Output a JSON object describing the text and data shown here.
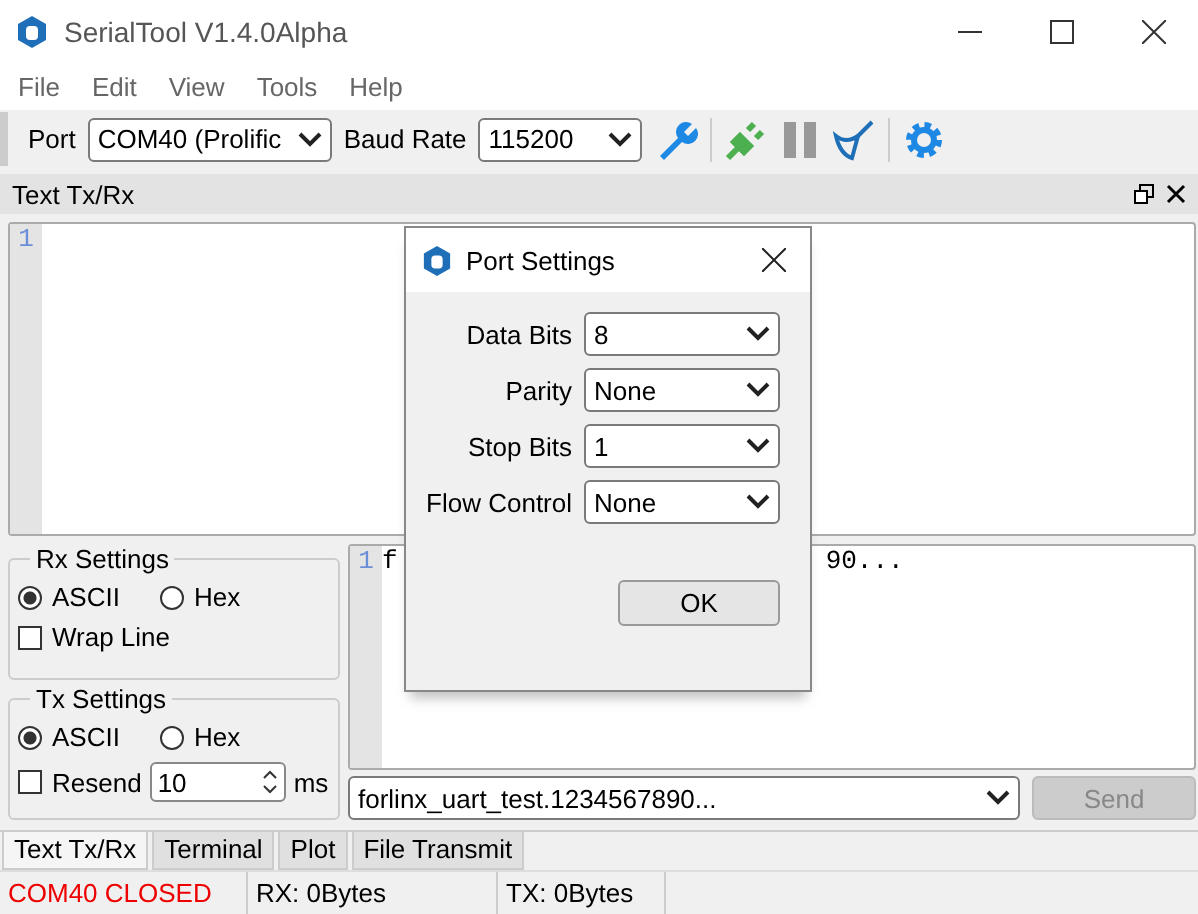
{
  "window": {
    "title": "SerialTool V1.4.0Alpha"
  },
  "menu": [
    "File",
    "Edit",
    "View",
    "Tools",
    "Help"
  ],
  "toolbar": {
    "port_label": "Port",
    "port_value": "COM40 (Prolific",
    "baud_label": "Baud Rate",
    "baud_value": "115200"
  },
  "dock": {
    "title": "Text Tx/Rx",
    "line_number": "1"
  },
  "rx_settings": {
    "title": "Rx Settings",
    "options": [
      {
        "label": "ASCII",
        "selected": true
      },
      {
        "label": "Hex",
        "selected": false
      }
    ],
    "wrap_line": {
      "label": "Wrap Line",
      "checked": false
    }
  },
  "tx_settings": {
    "title": "Tx Settings",
    "options": [
      {
        "label": "ASCII",
        "selected": true
      },
      {
        "label": "Hex",
        "selected": false
      }
    ],
    "resend": {
      "label": "Resend",
      "checked": false
    },
    "interval": "10",
    "unit": "ms"
  },
  "send_editor": {
    "line_number": "1",
    "text_start": "f",
    "text_end": "90..."
  },
  "send_input": {
    "value": "forlinx_uart_test.1234567890..."
  },
  "send_button": {
    "label": "Send",
    "disabled": true
  },
  "tabs": [
    {
      "label": "Text Tx/Rx",
      "selected": true
    },
    {
      "label": "Terminal",
      "selected": false
    },
    {
      "label": "Plot",
      "selected": false
    },
    {
      "label": "File Transmit",
      "selected": false
    }
  ],
  "status_bar": {
    "port_status": "COM40 CLOSED",
    "rx": "RX: 0Bytes",
    "tx": "TX: 0Bytes"
  },
  "dialog": {
    "title": "Port Settings",
    "fields": [
      {
        "label": "Data Bits",
        "value": "8"
      },
      {
        "label": "Parity",
        "value": "None"
      },
      {
        "label": "Stop Bits",
        "value": "1"
      },
      {
        "label": "Flow Control",
        "value": "None"
      }
    ],
    "ok": "OK"
  }
}
